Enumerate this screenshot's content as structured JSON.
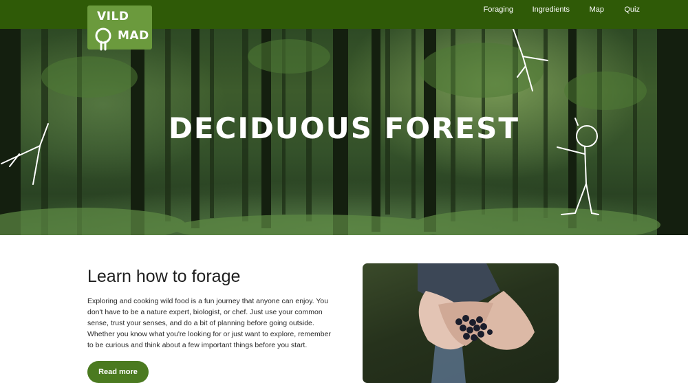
{
  "brand": {
    "line1": "VILD",
    "line2": "MAD"
  },
  "nav": {
    "items": [
      {
        "label": "Foraging"
      },
      {
        "label": "Ingredients"
      },
      {
        "label": "Map"
      },
      {
        "label": "Quiz"
      }
    ]
  },
  "hero": {
    "title": "DECIDUOUS FOREST",
    "image": "deciduous-forest-photo",
    "decorations": [
      "stick-figure-icon",
      "twig-doodle-icon"
    ]
  },
  "intro": {
    "heading": "Learn how to forage",
    "body": "Exploring and cooking wild food is a fun journey that anyone can enjoy. You don't have to be a nature expert, biologist, or chef. Just use your common sense, trust your senses, and do a bit of planning before going outside. Whether you know what you're looking for or just want to explore, remember to be curious and think about a few important things before you start.",
    "button_label": "Read more",
    "photo": "hands-holding-blueberries-photo"
  },
  "colors": {
    "topbar": "#2f5a07",
    "logo_bg": "#6b9a3d",
    "button": "#4b7a20",
    "text": "#1f1f1f"
  }
}
